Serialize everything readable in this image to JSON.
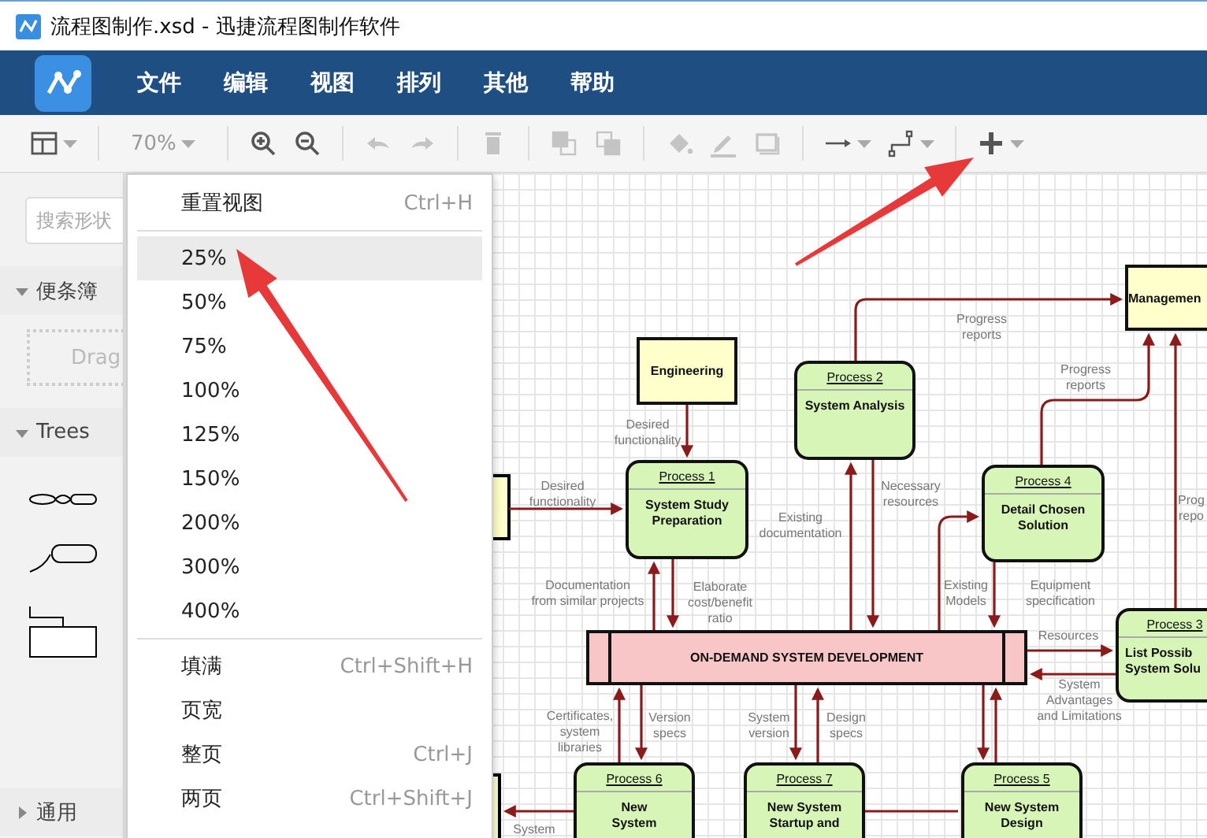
{
  "window": {
    "title": "流程图制作.xsd - 迅捷流程图制作软件"
  },
  "menu_bar": [
    "文件",
    "编辑",
    "视图",
    "排列",
    "其他",
    "帮助"
  ],
  "toolbar": [
    [
      {
        "kind": "layout",
        "disabled": false,
        "dropdown": true
      }
    ],
    [
      {
        "kind": "zoom",
        "label": "70%",
        "dropdown": true
      }
    ],
    [
      {
        "kind": "zoom_in",
        "disabled": false
      },
      {
        "kind": "zoom_out",
        "disabled": false
      }
    ],
    [
      {
        "kind": "undo",
        "disabled": true
      },
      {
        "kind": "redo",
        "disabled": true
      }
    ],
    [
      {
        "kind": "delete",
        "disabled": true
      }
    ],
    [
      {
        "kind": "to_front",
        "disabled": true
      },
      {
        "kind": "to_back",
        "disabled": true
      }
    ],
    [
      {
        "kind": "fill",
        "disabled": true
      },
      {
        "kind": "line_color",
        "disabled": true
      },
      {
        "kind": "shadow",
        "disabled": true
      }
    ],
    [
      {
        "kind": "arrow",
        "disabled": false,
        "dropdown": true
      },
      {
        "kind": "waypoints",
        "disabled": false,
        "dropdown": true
      }
    ],
    [
      {
        "kind": "insert",
        "disabled": false,
        "dropdown": true
      }
    ]
  ],
  "sidebar": {
    "search": {
      "placeholder": "搜索形状"
    },
    "sections": [
      {
        "title": "便条簿",
        "expanded": true,
        "kind": "scratchpad",
        "hint": "Drag"
      },
      {
        "title": "Trees",
        "expanded": true,
        "kind": "shapes"
      },
      {
        "title": "通用",
        "expanded": false
      }
    ]
  },
  "zoom_menu": {
    "groups": [
      [
        {
          "label": "重置视图",
          "shortcut": "Ctrl+H",
          "selected": false
        }
      ],
      [
        {
          "label": "25%",
          "selected": true
        },
        {
          "label": "50%",
          "selected": false
        },
        {
          "label": "75%",
          "selected": false
        },
        {
          "label": "100%",
          "selected": false
        },
        {
          "label": "125%",
          "selected": false
        },
        {
          "label": "150%",
          "selected": false
        },
        {
          "label": "200%",
          "selected": false
        },
        {
          "label": "300%",
          "selected": false
        },
        {
          "label": "400%",
          "selected": false
        }
      ],
      [
        {
          "label": "填满",
          "shortcut": "Ctrl+Shift+H",
          "selected": false
        },
        {
          "label": "页宽",
          "selected": false
        },
        {
          "label": "整页",
          "shortcut": "Ctrl+J",
          "selected": false
        },
        {
          "label": "两页",
          "shortcut": "Ctrl+Shift+J",
          "selected": false
        }
      ]
    ]
  },
  "diagram": {
    "nodes": [
      {
        "kind": "entity",
        "lines": [
          "Managemen"
        ]
      },
      {
        "kind": "entity",
        "lines": [
          "Engineering"
        ]
      },
      {
        "kind": "process",
        "title": "Process 2",
        "lines": [
          "System Analysis"
        ]
      },
      {
        "kind": "process",
        "title": "Process 1",
        "lines": [
          "System Study",
          "Preparation"
        ]
      },
      {
        "kind": "process",
        "title": "Process 4",
        "lines": [
          "Detail Chosen",
          "Solution"
        ]
      },
      {
        "kind": "store",
        "lines": [
          "ON-DEMAND SYSTEM DEVELOPMENT"
        ]
      },
      {
        "kind": "process",
        "title": "Process 3",
        "lines": [
          "List Possib",
          "System Solu"
        ]
      },
      {
        "kind": "process",
        "title": "Process 6",
        "lines": [
          "New",
          "System"
        ]
      },
      {
        "kind": "process",
        "title": "Process 7",
        "lines": [
          "New System",
          "Startup and"
        ]
      },
      {
        "kind": "process",
        "title": "Process 5",
        "lines": [
          "New System",
          "Design"
        ]
      }
    ],
    "labels": [
      {
        "lines": [
          "Progress",
          "reports"
        ]
      },
      {
        "lines": [
          "Desired",
          "functionality"
        ]
      },
      {
        "lines": [
          "Progress",
          "reports"
        ]
      },
      {
        "lines": [
          "Desired",
          "functionality"
        ]
      },
      {
        "lines": [
          "Necessary",
          "resources"
        ]
      },
      {
        "lines": [
          "Prog",
          "repo"
        ]
      },
      {
        "lines": [
          "Existing",
          "documentation"
        ]
      },
      {
        "lines": [
          "Documentation",
          "from similar projects"
        ]
      },
      {
        "lines": [
          "Elaborate",
          "cost/benefit",
          "ratio"
        ]
      },
      {
        "lines": [
          "Existing",
          "Models"
        ]
      },
      {
        "lines": [
          "Equipment",
          "specification"
        ]
      },
      {
        "lines": [
          "Resources"
        ]
      },
      {
        "lines": [
          "System",
          "Advantages",
          "and Limitations"
        ]
      },
      {
        "lines": [
          "Certificates,",
          "system",
          "libraries"
        ]
      },
      {
        "lines": [
          "Version",
          "specs"
        ]
      },
      {
        "lines": [
          "System",
          "version"
        ]
      },
      {
        "lines": [
          "Design",
          "specs"
        ]
      },
      {
        "lines": [
          "System"
        ]
      }
    ]
  }
}
